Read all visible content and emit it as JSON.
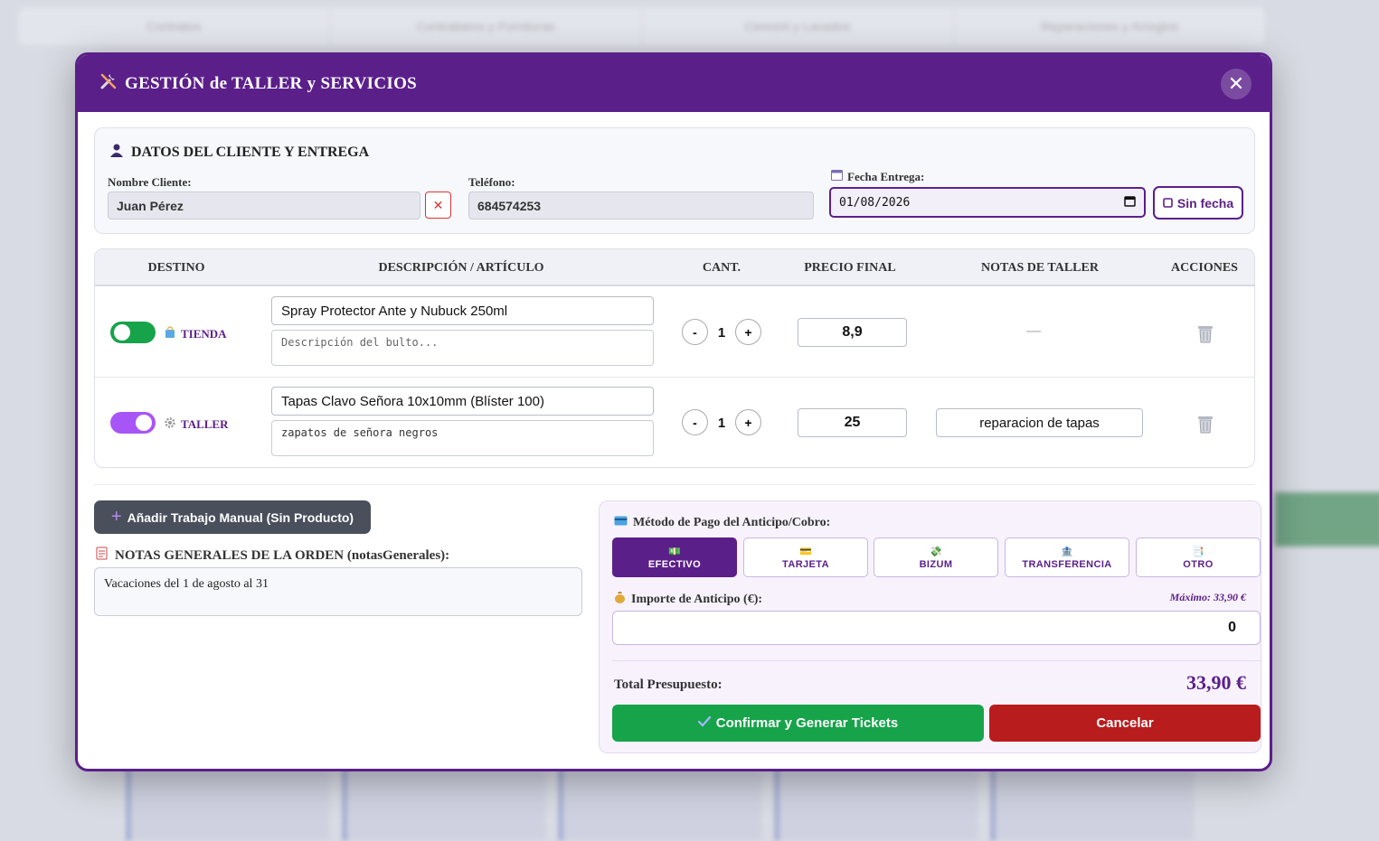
{
  "background": {
    "tabs": [
      "Contratos",
      "Contrabiens y Fornituras",
      "Cenrent y Lavados",
      "Reparaciones y Arreglos"
    ]
  },
  "modal": {
    "title": "GESTIÓN de TALLER y SERVICIOS",
    "title_icon": "tools-icon",
    "close_label": "✕"
  },
  "client": {
    "section_title": "DATOS DEL CLIENTE Y ENTREGA",
    "name_label": "Nombre Cliente:",
    "name_value": "Juan Pérez",
    "clear_label": "✕",
    "phone_label": "Teléfono:",
    "phone_value": "684574253",
    "date_label": "Fecha Entrega:",
    "date_value": "01/08/2026",
    "no_date_label": "Sin fecha"
  },
  "table": {
    "headers": {
      "destino": "DESTINO",
      "descripcion": "DESCRIPCIÓN / ARTÍCULO",
      "cant": "CANT.",
      "precio": "PRECIO FINAL",
      "notas": "NOTAS DE TALLER",
      "acciones": "ACCIONES"
    },
    "rows": [
      {
        "destino": "TIENDA",
        "toggle_on": true,
        "toggle_color": "#16a34a",
        "descripcion": "Spray Protector Ante y Nubuck 250ml",
        "sub_placeholder": "Descripción del bulto...",
        "sub_value": "",
        "cantidad": "1",
        "precio": "8,9",
        "notas": "—",
        "minus": "-",
        "plus": "+"
      },
      {
        "destino": "TALLER",
        "toggle_on": true,
        "toggle_color": "#a855f7",
        "descripcion": "Tapas Clavo Señora 10x10mm (Blíster 100)",
        "sub_placeholder": "",
        "sub_value": "zapatos de señora negros",
        "cantidad": "1",
        "precio": "25",
        "notas": "reparacion de tapas",
        "minus": "-",
        "plus": "+"
      }
    ]
  },
  "add_manual_label": "Añadir Trabajo Manual (Sin Producto)",
  "notas_generales": {
    "title": "NOTAS GENERALES DE LA ORDEN (notasGenerales):",
    "value": "Vacaciones del 1 de agosto al 31"
  },
  "payment": {
    "title": "Método de Pago del Anticipo/Cobro:",
    "options": [
      {
        "label": "EFECTIVO",
        "icon": "💵",
        "active": true
      },
      {
        "label": "TARJETA",
        "icon": "💳",
        "active": false
      },
      {
        "label": "BIZUM",
        "icon": "💸",
        "active": false
      },
      {
        "label": "TRANSFERENCIA",
        "icon": "🏦",
        "active": false
      },
      {
        "label": "OTRO",
        "icon": "📑",
        "active": false
      }
    ],
    "importe_label": "Importe de Anticipo (€):",
    "max_label": "Máximo: 33,90 €",
    "importe_value": "0",
    "total_label": "Total Presupuesto:",
    "total_value": "33,90 €",
    "confirm_label": "Confirmar y Generar Tickets",
    "cancel_label": "Cancelar"
  },
  "colors": {
    "brand": "#5b1f8a",
    "confirm": "#16a34a",
    "cancel": "#b91c1c"
  }
}
